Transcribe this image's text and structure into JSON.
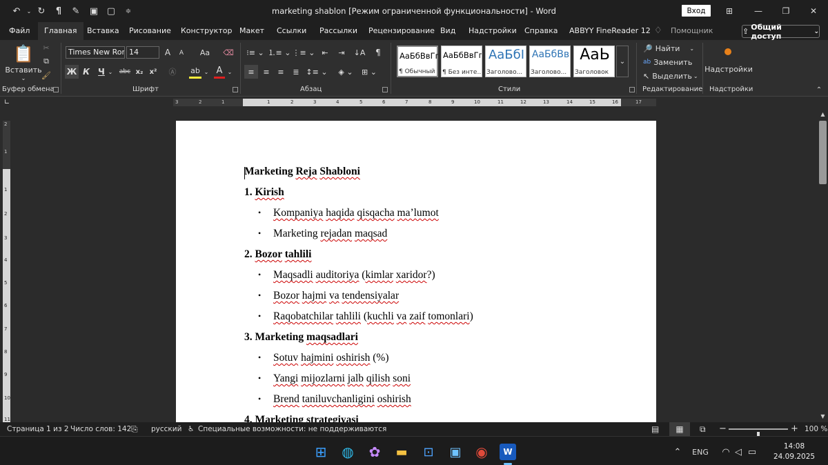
{
  "window": {
    "title": "marketing shablon [Режим ограниченной функциональности]  -  Word",
    "signin": "Вход",
    "quick_access": [
      "undo-icon",
      "redo-icon",
      "pilcrow-icon",
      "spell-icon",
      "save-icon",
      "new-doc-icon",
      "customize-icon"
    ]
  },
  "menu": {
    "tabs": [
      "Файл",
      "Главная",
      "Вставка",
      "Рисование",
      "Конструктор",
      "Макет",
      "Ссылки",
      "Рассылки",
      "Рецензирование",
      "Вид",
      "Надстройки",
      "Справка",
      "ABBYY FineReader 12"
    ],
    "active_tab": "Главная",
    "helper": "Помощник",
    "share": "Общий доступ"
  },
  "ribbon": {
    "clipboard": {
      "paste": "Вставить",
      "label": "Буфер обмена"
    },
    "font": {
      "name": "Times New Ror",
      "size": "14",
      "label": "Шрифт",
      "bold": "Ж",
      "italic": "К",
      "underline": "Ч",
      "strike": "abc",
      "sub": "x₂",
      "sup": "x²",
      "grow": "A",
      "shrink": "A",
      "case": "Aa"
    },
    "paragraph": {
      "label": "Абзац"
    },
    "styles": {
      "label": "Стили",
      "items": [
        {
          "sample": "АаБбВвГг,",
          "name": "¶ Обычный"
        },
        {
          "sample": "АаБбВвГг,",
          "name": "¶ Без инте..."
        },
        {
          "sample": "АаБбІ",
          "name": "Заголово..."
        },
        {
          "sample": "АаБбВв",
          "name": "Заголово..."
        },
        {
          "sample": "АаЬ",
          "name": "Заголовок"
        }
      ]
    },
    "editing": {
      "find": "Найти",
      "replace": "Заменить",
      "select": "Выделить",
      "label": "Редактирование"
    },
    "addins": {
      "button": "Надстройки",
      "label": "Надстройки"
    }
  },
  "ruler": {
    "h_ticks": [
      "3",
      "2",
      "1",
      "1",
      "2",
      "3",
      "4",
      "5",
      "6",
      "7",
      "8",
      "9",
      "10",
      "11",
      "12",
      "13",
      "14",
      "15",
      "16",
      "17"
    ],
    "v_ticks": [
      "2",
      "1",
      "1",
      "2",
      "3",
      "4",
      "5",
      "6",
      "7",
      "8",
      "9",
      "10",
      "11"
    ]
  },
  "document": {
    "lines": [
      {
        "type": "title",
        "text": "Marketing Reja Shabloni"
      },
      {
        "type": "heading",
        "text": "1. Kirish"
      },
      {
        "type": "bullet",
        "text": "Kompaniya haqida qisqacha ma’lumot"
      },
      {
        "type": "bullet",
        "text": "Marketing rejadan maqsad"
      },
      {
        "type": "heading",
        "text": "2. Bozor tahlili"
      },
      {
        "type": "bullet",
        "text": "Maqsadli auditoriya (kimlar xaridor?)"
      },
      {
        "type": "bullet",
        "text": "Bozor hajmi va tendensiyalar"
      },
      {
        "type": "bullet",
        "text": "Raqobatchilar tahlili (kuchli va zaif tomonlari)"
      },
      {
        "type": "heading",
        "text": "3. Marketing maqsadlari"
      },
      {
        "type": "bullet",
        "text": "Sotuv hajmini oshirish (%)"
      },
      {
        "type": "bullet",
        "text": "Yangi mijozlarni jalb qilish soni"
      },
      {
        "type": "bullet",
        "text": "Brend taniluvchanligini oshirish"
      },
      {
        "type": "heading",
        "text": "4. Marketing strategiyasi"
      }
    ]
  },
  "status": {
    "page": "Страница 1 из 2",
    "words": "Число слов: 142",
    "language": "русский",
    "accessibility": "Специальные возможности: не поддерживаются",
    "zoom": "100 %",
    "zoom_level": 1.0
  },
  "taskbar": {
    "apps": [
      "windows-start-icon",
      "edge-icon",
      "copilot-icon",
      "file-explorer-icon",
      "store-icon",
      "photos-icon",
      "chrome-icon",
      "word-icon"
    ],
    "lang": "ENG",
    "time": "14:08",
    "date": "24.09.2025"
  },
  "colors": {
    "accent_word": "#185abd",
    "squiggle": "#cc0000",
    "addin_dot": "#e8811a"
  }
}
